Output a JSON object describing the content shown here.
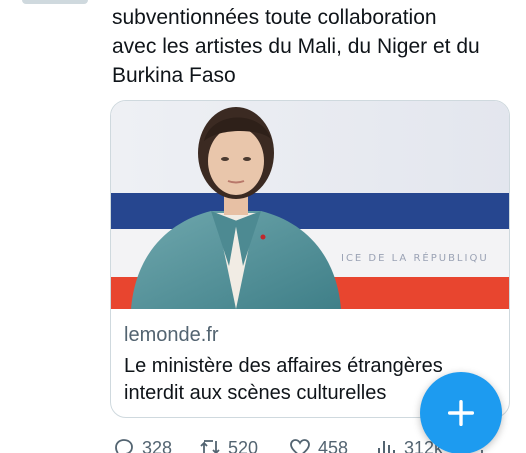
{
  "tweet": {
    "text": "subventionnées toute collaboration\navec les artistes du Mali, du Niger et du\nBurkina Faso"
  },
  "card": {
    "domain": "lemonde.fr",
    "title": "Le ministère des affaires étrangères\ninterdit aux scènes culturelles",
    "image_banner_text": "ICE DE LA RÉPUBLIQU"
  },
  "actions": {
    "replies": "328",
    "retweets": "520",
    "likes": "458",
    "views": "312k"
  },
  "colors": {
    "accent": "#1d9bf0",
    "text_primary": "#0f1419",
    "text_secondary": "#536471",
    "border": "#cfd9de"
  },
  "icons": {
    "reply": "reply-icon",
    "retweet": "retweet-icon",
    "like": "heart-icon",
    "views": "bar-chart-icon",
    "share": "share-icon",
    "compose": "plus-icon"
  }
}
